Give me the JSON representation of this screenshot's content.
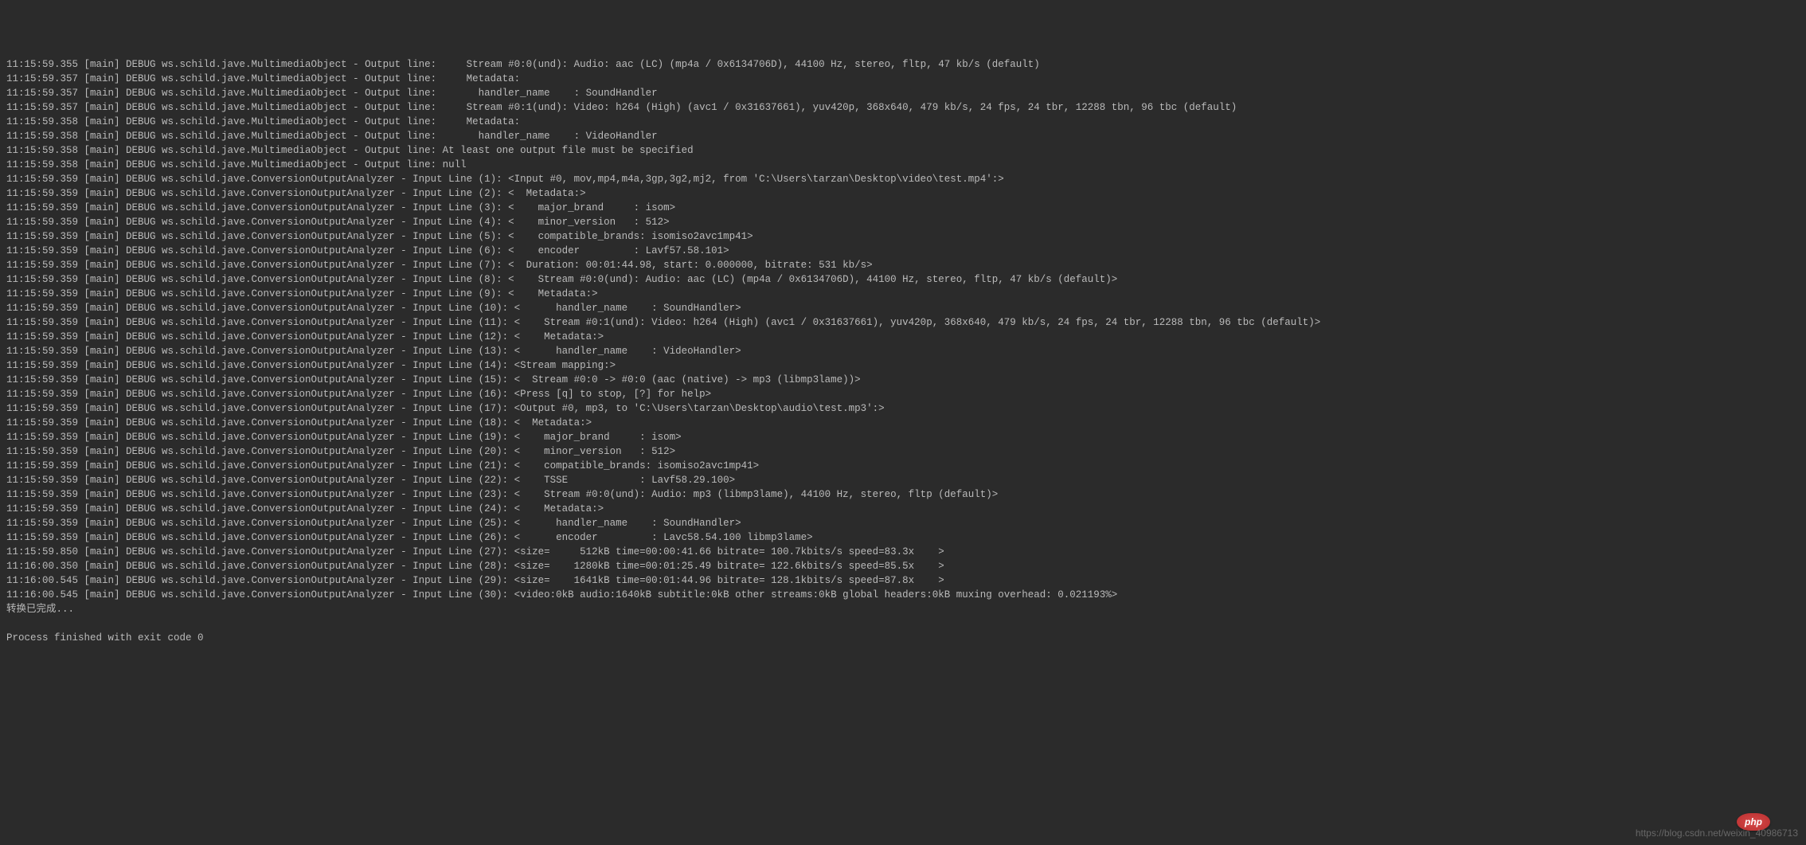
{
  "lines": [
    "11:15:59.355 [main] DEBUG ws.schild.jave.MultimediaObject - Output line:     Stream #0:0(und): Audio: aac (LC) (mp4a / 0x6134706D), 44100 Hz, stereo, fltp, 47 kb/s (default)",
    "11:15:59.357 [main] DEBUG ws.schild.jave.MultimediaObject - Output line:     Metadata:",
    "11:15:59.357 [main] DEBUG ws.schild.jave.MultimediaObject - Output line:       handler_name    : SoundHandler",
    "11:15:59.357 [main] DEBUG ws.schild.jave.MultimediaObject - Output line:     Stream #0:1(und): Video: h264 (High) (avc1 / 0x31637661), yuv420p, 368x640, 479 kb/s, 24 fps, 24 tbr, 12288 tbn, 96 tbc (default)",
    "11:15:59.358 [main] DEBUG ws.schild.jave.MultimediaObject - Output line:     Metadata:",
    "11:15:59.358 [main] DEBUG ws.schild.jave.MultimediaObject - Output line:       handler_name    : VideoHandler",
    "11:15:59.358 [main] DEBUG ws.schild.jave.MultimediaObject - Output line: At least one output file must be specified",
    "11:15:59.358 [main] DEBUG ws.schild.jave.MultimediaObject - Output line: null",
    "11:15:59.359 [main] DEBUG ws.schild.jave.ConversionOutputAnalyzer - Input Line (1): <Input #0, mov,mp4,m4a,3gp,3g2,mj2, from 'C:\\Users\\tarzan\\Desktop\\video\\test.mp4':>",
    "11:15:59.359 [main] DEBUG ws.schild.jave.ConversionOutputAnalyzer - Input Line (2): <  Metadata:>",
    "11:15:59.359 [main] DEBUG ws.schild.jave.ConversionOutputAnalyzer - Input Line (3): <    major_brand     : isom>",
    "11:15:59.359 [main] DEBUG ws.schild.jave.ConversionOutputAnalyzer - Input Line (4): <    minor_version   : 512>",
    "11:15:59.359 [main] DEBUG ws.schild.jave.ConversionOutputAnalyzer - Input Line (5): <    compatible_brands: isomiso2avc1mp41>",
    "11:15:59.359 [main] DEBUG ws.schild.jave.ConversionOutputAnalyzer - Input Line (6): <    encoder         : Lavf57.58.101>",
    "11:15:59.359 [main] DEBUG ws.schild.jave.ConversionOutputAnalyzer - Input Line (7): <  Duration: 00:01:44.98, start: 0.000000, bitrate: 531 kb/s>",
    "11:15:59.359 [main] DEBUG ws.schild.jave.ConversionOutputAnalyzer - Input Line (8): <    Stream #0:0(und): Audio: aac (LC) (mp4a / 0x6134706D), 44100 Hz, stereo, fltp, 47 kb/s (default)>",
    "11:15:59.359 [main] DEBUG ws.schild.jave.ConversionOutputAnalyzer - Input Line (9): <    Metadata:>",
    "11:15:59.359 [main] DEBUG ws.schild.jave.ConversionOutputAnalyzer - Input Line (10): <      handler_name    : SoundHandler>",
    "11:15:59.359 [main] DEBUG ws.schild.jave.ConversionOutputAnalyzer - Input Line (11): <    Stream #0:1(und): Video: h264 (High) (avc1 / 0x31637661), yuv420p, 368x640, 479 kb/s, 24 fps, 24 tbr, 12288 tbn, 96 tbc (default)>",
    "11:15:59.359 [main] DEBUG ws.schild.jave.ConversionOutputAnalyzer - Input Line (12): <    Metadata:>",
    "11:15:59.359 [main] DEBUG ws.schild.jave.ConversionOutputAnalyzer - Input Line (13): <      handler_name    : VideoHandler>",
    "11:15:59.359 [main] DEBUG ws.schild.jave.ConversionOutputAnalyzer - Input Line (14): <Stream mapping:>",
    "11:15:59.359 [main] DEBUG ws.schild.jave.ConversionOutputAnalyzer - Input Line (15): <  Stream #0:0 -> #0:0 (aac (native) -> mp3 (libmp3lame))>",
    "11:15:59.359 [main] DEBUG ws.schild.jave.ConversionOutputAnalyzer - Input Line (16): <Press [q] to stop, [?] for help>",
    "11:15:59.359 [main] DEBUG ws.schild.jave.ConversionOutputAnalyzer - Input Line (17): <Output #0, mp3, to 'C:\\Users\\tarzan\\Desktop\\audio\\test.mp3':>",
    "11:15:59.359 [main] DEBUG ws.schild.jave.ConversionOutputAnalyzer - Input Line (18): <  Metadata:>",
    "11:15:59.359 [main] DEBUG ws.schild.jave.ConversionOutputAnalyzer - Input Line (19): <    major_brand     : isom>",
    "11:15:59.359 [main] DEBUG ws.schild.jave.ConversionOutputAnalyzer - Input Line (20): <    minor_version   : 512>",
    "11:15:59.359 [main] DEBUG ws.schild.jave.ConversionOutputAnalyzer - Input Line (21): <    compatible_brands: isomiso2avc1mp41>",
    "11:15:59.359 [main] DEBUG ws.schild.jave.ConversionOutputAnalyzer - Input Line (22): <    TSSE            : Lavf58.29.100>",
    "11:15:59.359 [main] DEBUG ws.schild.jave.ConversionOutputAnalyzer - Input Line (23): <    Stream #0:0(und): Audio: mp3 (libmp3lame), 44100 Hz, stereo, fltp (default)>",
    "11:15:59.359 [main] DEBUG ws.schild.jave.ConversionOutputAnalyzer - Input Line (24): <    Metadata:>",
    "11:15:59.359 [main] DEBUG ws.schild.jave.ConversionOutputAnalyzer - Input Line (25): <      handler_name    : SoundHandler>",
    "11:15:59.359 [main] DEBUG ws.schild.jave.ConversionOutputAnalyzer - Input Line (26): <      encoder         : Lavc58.54.100 libmp3lame>",
    "11:15:59.850 [main] DEBUG ws.schild.jave.ConversionOutputAnalyzer - Input Line (27): <size=     512kB time=00:00:41.66 bitrate= 100.7kbits/s speed=83.3x    >",
    "11:16:00.350 [main] DEBUG ws.schild.jave.ConversionOutputAnalyzer - Input Line (28): <size=    1280kB time=00:01:25.49 bitrate= 122.6kbits/s speed=85.5x    >",
    "11:16:00.545 [main] DEBUG ws.schild.jave.ConversionOutputAnalyzer - Input Line (29): <size=    1641kB time=00:01:44.96 bitrate= 128.1kbits/s speed=87.8x    >",
    "11:16:00.545 [main] DEBUG ws.schild.jave.ConversionOutputAnalyzer - Input Line (30): <video:0kB audio:1640kB subtitle:0kB other streams:0kB global headers:0kB muxing overhead: 0.021193%>",
    "转换已完成...",
    "",
    "Process finished with exit code 0"
  ],
  "watermark": "https://blog.csdn.net/weixin_40986713",
  "badge": "php"
}
